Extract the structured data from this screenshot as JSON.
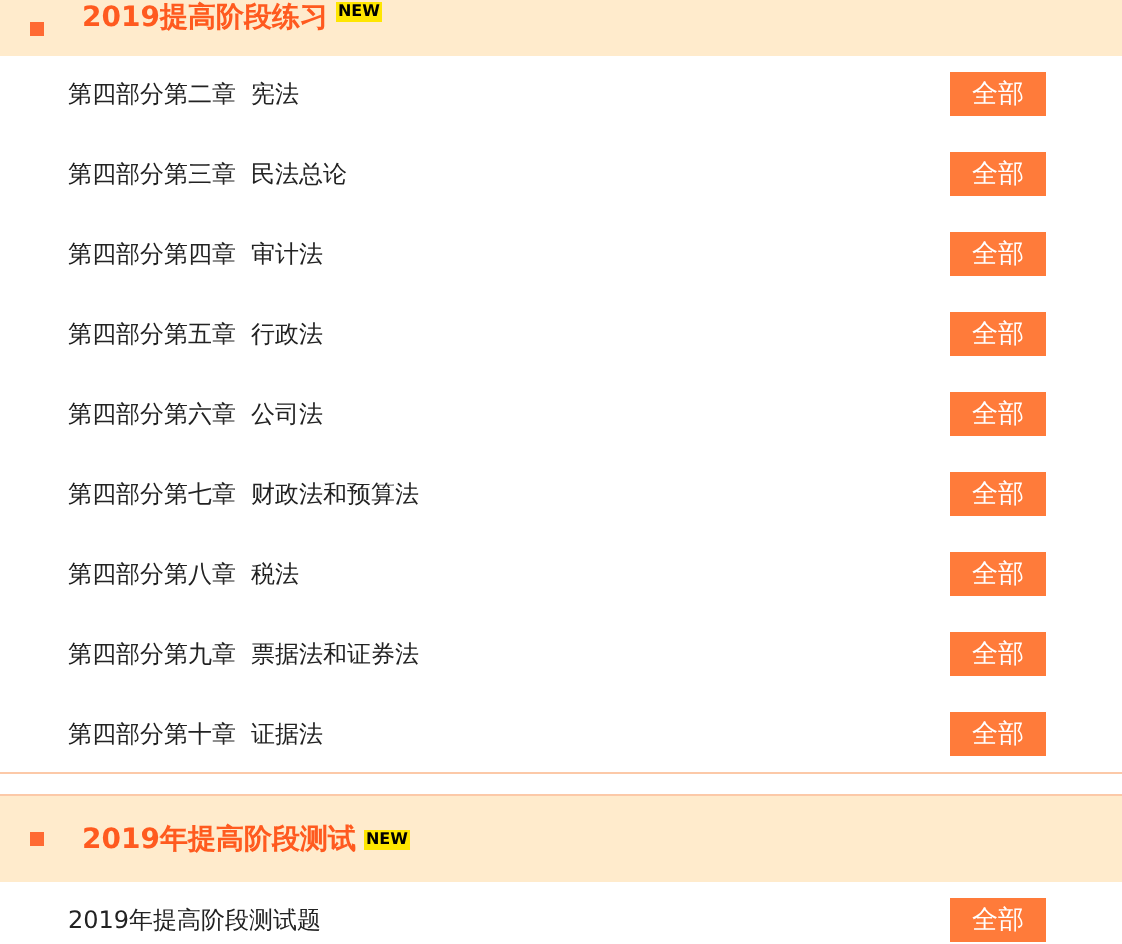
{
  "sections": [
    {
      "title": "2019提高阶段练习",
      "badge": "NEW",
      "items": [
        {
          "label": "第四部分第二章  宪法",
          "button": "全部"
        },
        {
          "label": "第四部分第三章  民法总论",
          "button": "全部"
        },
        {
          "label": "第四部分第四章  审计法",
          "button": "全部"
        },
        {
          "label": "第四部分第五章  行政法",
          "button": "全部"
        },
        {
          "label": "第四部分第六章  公司法",
          "button": "全部"
        },
        {
          "label": "第四部分第七章  财政法和预算法",
          "button": "全部"
        },
        {
          "label": "第四部分第八章  税法",
          "button": "全部"
        },
        {
          "label": "第四部分第九章  票据法和证券法",
          "button": "全部"
        },
        {
          "label": "第四部分第十章  证据法",
          "button": "全部"
        }
      ]
    },
    {
      "title": "2019年提高阶段测试",
      "badge": "NEW",
      "items": [
        {
          "label": "2019年提高阶段测试题",
          "button": "全部"
        }
      ]
    }
  ]
}
